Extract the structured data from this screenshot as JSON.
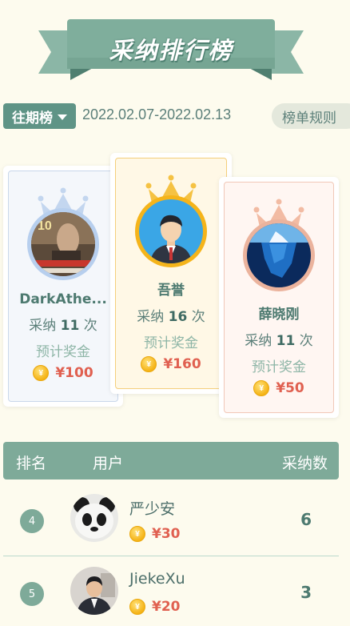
{
  "banner": {
    "title": "采纳排行榜"
  },
  "filter": {
    "period_label": "往期榜",
    "date_range": "2022.02.07-2022.02.13",
    "rules_label": "榜单规则"
  },
  "podium": [
    {
      "rank": 2,
      "name": "DarkAthe...",
      "count_prefix": "采纳",
      "count": "11",
      "count_suffix": "次",
      "prize_label": "预计奖金",
      "prize": "¥100",
      "avatar": "game-poster-avatar",
      "crown_color": "#c3d6ef"
    },
    {
      "rank": 1,
      "name": "吾誉",
      "count_prefix": "采纳",
      "count": "16",
      "count_suffix": "次",
      "prize_label": "预计奖金",
      "prize": "¥160",
      "avatar": "businessman-avatar",
      "crown_color": "#f5c243"
    },
    {
      "rank": 3,
      "name": "薛晓刚",
      "count_prefix": "采纳",
      "count": "11",
      "count_suffix": "次",
      "prize_label": "预计奖金",
      "prize": "¥50",
      "avatar": "iceberg-avatar",
      "crown_color": "#f2bba3"
    }
  ],
  "table": {
    "headers": {
      "rank": "排名",
      "user": "用户",
      "count": "采纳数"
    },
    "rows": [
      {
        "rank": "4",
        "name": "严少安",
        "prize": "¥30",
        "count": "6",
        "avatar": "panda-avatar"
      },
      {
        "rank": "5",
        "name": "JiekeXu",
        "prize": "¥20",
        "count": "3",
        "avatar": "photo-avatar"
      }
    ]
  },
  "coin_symbol": "¥",
  "colors": {
    "background": "#fdfbee",
    "accent": "#7eaa99",
    "prize": "#e06050",
    "gold": "#f5c243"
  }
}
